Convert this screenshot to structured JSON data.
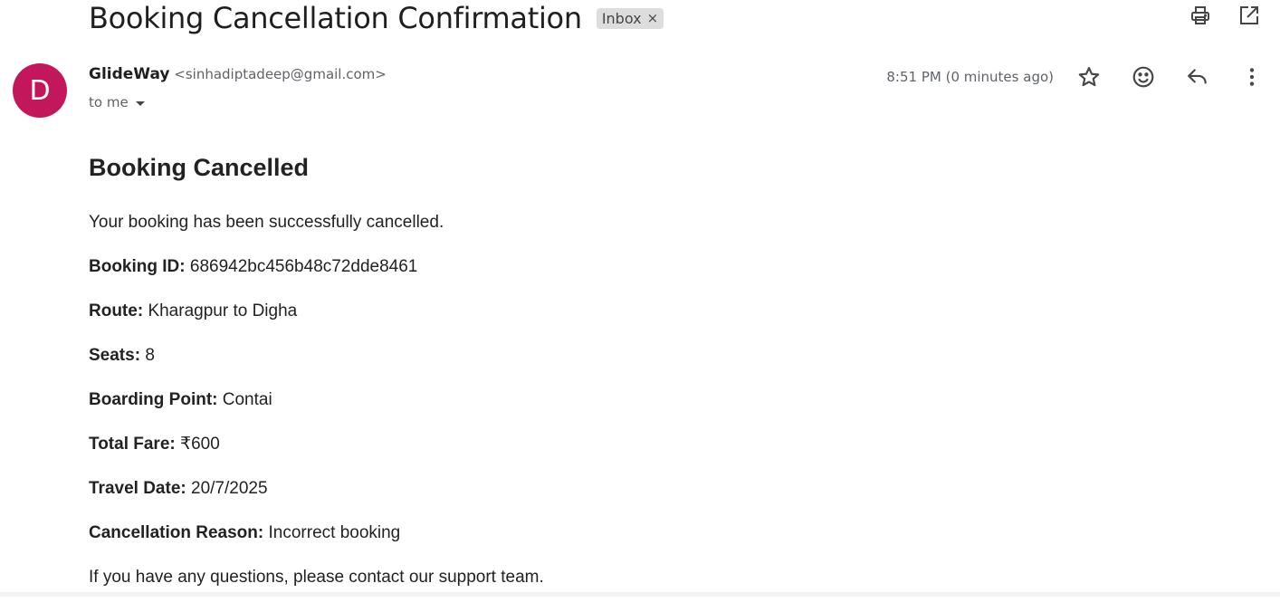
{
  "email": {
    "subject": "Booking Cancellation Confirmation",
    "label": "Inbox",
    "label_close": "×",
    "avatar_letter": "D",
    "avatar_color": "#c2185b",
    "sender_name": "GlideWay",
    "sender_email": "<sinhadiptadeep@gmail.com>",
    "recipient": "to me",
    "timestamp": "8:51 PM (0 minutes ago)"
  },
  "icons": {
    "top": [
      "print-icon",
      "open-in-new-window-icon"
    ],
    "meta": [
      "star-icon",
      "emoji-icon",
      "reply-icon",
      "more-vert-icon"
    ]
  },
  "content": {
    "heading": "Booking Cancelled",
    "intro": "Your booking has been successfully cancelled.",
    "fields": [
      {
        "label": "Booking ID:",
        "value": "686942bc456b48c72dde8461"
      },
      {
        "label": "Route:",
        "value": "Kharagpur to Digha"
      },
      {
        "label": "Seats:",
        "value": "8"
      },
      {
        "label": "Boarding Point:",
        "value": "Contai"
      },
      {
        "label": "Total Fare:",
        "value": "₹600"
      },
      {
        "label": "Travel Date:",
        "value": "20/7/2025"
      },
      {
        "label": "Cancellation Reason:",
        "value": "Incorrect booking"
      }
    ],
    "footer": "If you have any questions, please contact our support team."
  }
}
